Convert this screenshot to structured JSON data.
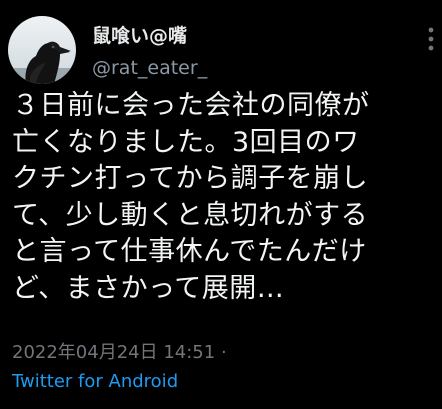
{
  "author": {
    "display_name": "鼠喰い@嘴",
    "handle": "@rat_eater_"
  },
  "tweet": {
    "lines": [
      "３日前に会った会社の同僚が",
      "亡くなりました。3回目のワ",
      "クチン打ってから調子を崩し",
      "て、少し動くと息切れがする",
      "と言って仕事休んでたんだけ",
      "ど、まさかって展開…"
    ]
  },
  "meta": {
    "timestamp": "2022年04月24日 14:51",
    "separator": "·",
    "source": "Twitter for Android"
  },
  "icons": {
    "avatar": "crow-avatar",
    "more": "more-dots-icon"
  },
  "colors": {
    "background": "#000000",
    "text": "#e7e9ea",
    "secondary": "#71767b",
    "link": "#1d9bf0"
  }
}
